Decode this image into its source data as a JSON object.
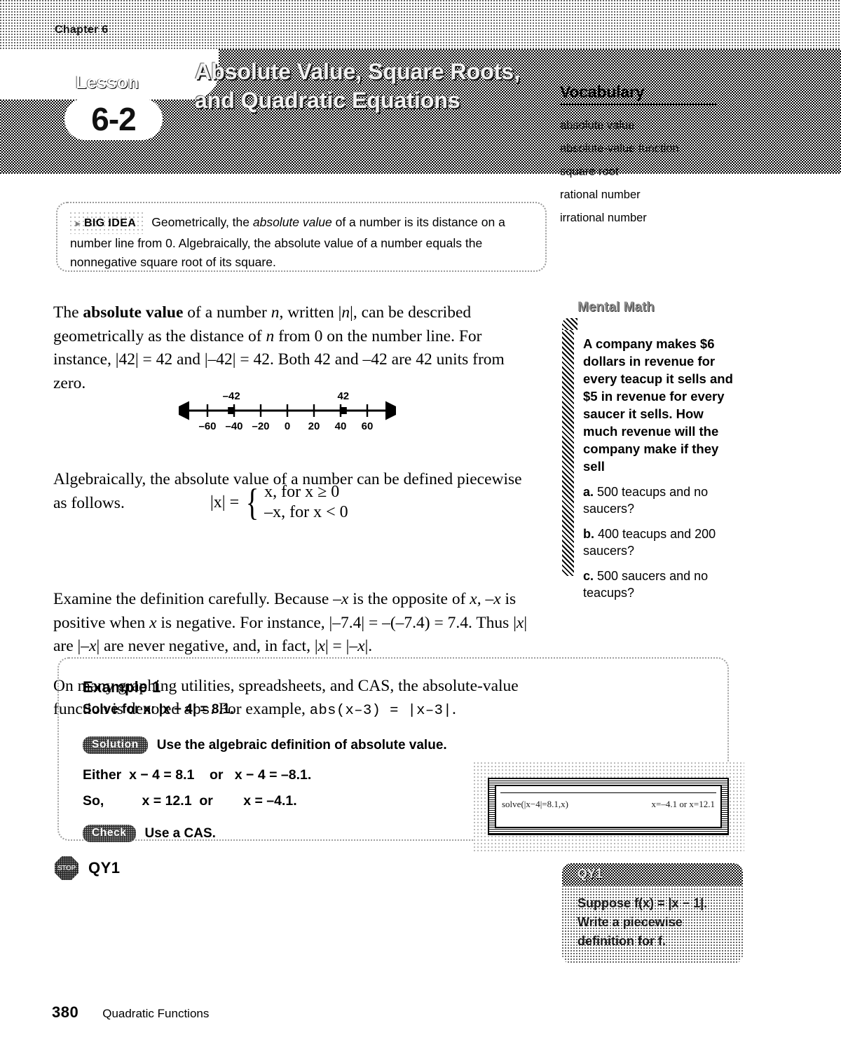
{
  "header": {
    "chapter_label": "Chapter 6",
    "lesson_word": "Lesson",
    "lesson_number": "6-2",
    "lesson_title": "Absolute Value, Square Roots, and Quadratic Equations"
  },
  "vocabulary": {
    "heading": "Vocabulary",
    "items": [
      "absolute value",
      "absolute-value function",
      "square root",
      "rational number",
      "irrational number"
    ]
  },
  "big_idea": {
    "arrow": "▸",
    "tag": "BIG IDEA",
    "text_before": "Geometrically, the ",
    "italic_term": "absolute value",
    "text_after": " of a number is its distance on a number line from 0. Algebraically, the absolute value of a number equals the nonnegative square root of its square."
  },
  "body": {
    "p1_a": "The ",
    "p1_bold": "absolute value",
    "p1_b": " of a number ",
    "p1_var1": "n",
    "p1_c": ", written |",
    "p1_var2": "n",
    "p1_d": "|, can be described geometrically as the distance of ",
    "p1_var3": "n",
    "p1_e": " from 0 on the number line. For instance, |42| = 42 and |–42| = 42. Both 42 and –42 are 42 units from zero.",
    "p2": "Algebraically, the absolute value of a number can be defined piecewise as follows.",
    "p3_a": "Examine the definition carefully. Because –",
    "p3_v1": "x",
    "p3_b": " is the opposite of ",
    "p3_v2": "x",
    "p3_c": ", –",
    "p3_v3": "x",
    "p3_d": " is positive when ",
    "p3_v4": "x",
    "p3_e": " is negative. For instance, |–7.4| = –(–7.4) = 7.4. Thus |",
    "p3_v5": "x",
    "p3_f": "| are |–",
    "p3_v6": "x",
    "p3_g": "| are never negative, and, in fact, |",
    "p3_v7": "x",
    "p3_h": "| = |–",
    "p3_v8": "x",
    "p3_i": "|.",
    "p4_a": "On many graphing utilities, spreadsheets, and CAS, the absolute-value function is denoted ",
    "p4_mono1": "abs",
    "p4_b": ". For example, ",
    "p4_mono2": "abs(x–3)  =  |x–3|",
    "p4_c": "."
  },
  "number_line": {
    "ticks": [
      -60,
      -40,
      -20,
      0,
      20,
      40,
      60
    ],
    "tick_labels": [
      "–60",
      "–40",
      "–20",
      "0",
      "20",
      "40",
      "60"
    ],
    "marked_points": [
      {
        "value": -42,
        "label": "–42"
      },
      {
        "value": 42,
        "label": "42"
      }
    ],
    "min": -70,
    "max": 70
  },
  "piecewise": {
    "lhs": "|x| =",
    "case1": "x, for x ≥ 0",
    "case2": "–x, for x < 0"
  },
  "mental_math": {
    "heading": "Mental Math",
    "question": "A company makes $6 dollars in revenue for every teacup it sells and $5 in revenue for every saucer it sells. How much revenue will the company make if they sell",
    "parts": [
      {
        "letter": "a.",
        "text": " 500 teacups and no saucers?"
      },
      {
        "letter": "b.",
        "text": " 400 teacups and 200 saucers?"
      },
      {
        "letter": "c.",
        "text": " 500 saucers and no teacups?"
      }
    ]
  },
  "example": {
    "title": "Example 1",
    "prompt": "Solve for x: |x − 4| = 8.1.",
    "solution_pill": "Solution",
    "solution_text": "Use the algebraic definition of absolute value.",
    "line_either": "Either  x − 4 = 8.1    or   x − 4 = –8.1.",
    "line_so": "So,          x = 12.1  or        x = –4.1.",
    "check_pill": "Check",
    "check_text": "Use a CAS."
  },
  "cas_screen": {
    "input": "solve(|x−4|=8.1,x)",
    "output": "x=–4.1 or x=12.1"
  },
  "qy_marker": {
    "stop_text": "STOP",
    "label": "QY1"
  },
  "qy_box": {
    "heading": "QY1",
    "text": "Suppose f(x) = |x − 1|. Write a piecewise definition for f."
  },
  "footer": {
    "page_number": "380",
    "title": "Quadratic Functions"
  },
  "colors": {
    "ink": "#000000",
    "paper": "#ffffff",
    "pill_bg": "#2a2a2a"
  }
}
